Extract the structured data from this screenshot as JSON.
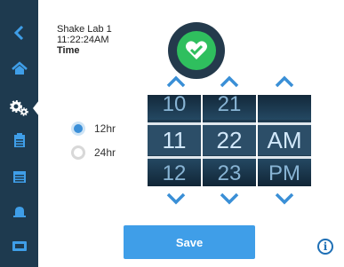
{
  "device": {
    "name": "Shake Lab 1",
    "clock": "11:22:24AM",
    "section_label": "Time"
  },
  "status": {
    "icon": "heart-check-icon",
    "color": "#2fbf5e"
  },
  "sidebar": {
    "items": [
      {
        "icon": "back-chevron-icon"
      },
      {
        "icon": "home-icon"
      },
      {
        "icon": "gears-icon",
        "active": true
      },
      {
        "icon": "clipboard-icon"
      },
      {
        "icon": "calendar-icon"
      },
      {
        "icon": "bell-icon"
      },
      {
        "icon": "display-icon"
      }
    ]
  },
  "format": {
    "options": [
      {
        "label": "12hr",
        "selected": true
      },
      {
        "label": "24hr",
        "selected": false
      }
    ]
  },
  "picker": {
    "hour": {
      "prev": "10",
      "current": "11",
      "next": "12"
    },
    "minute": {
      "prev": "21",
      "current": "22",
      "next": "23"
    },
    "period": {
      "prev": "",
      "current": "AM",
      "next": "PM"
    }
  },
  "actions": {
    "save_label": "Save",
    "info_label": "i"
  },
  "colors": {
    "sidebar": "#1e3a4f",
    "accent": "#3f9ee8",
    "arrow": "#3a8fd6"
  }
}
